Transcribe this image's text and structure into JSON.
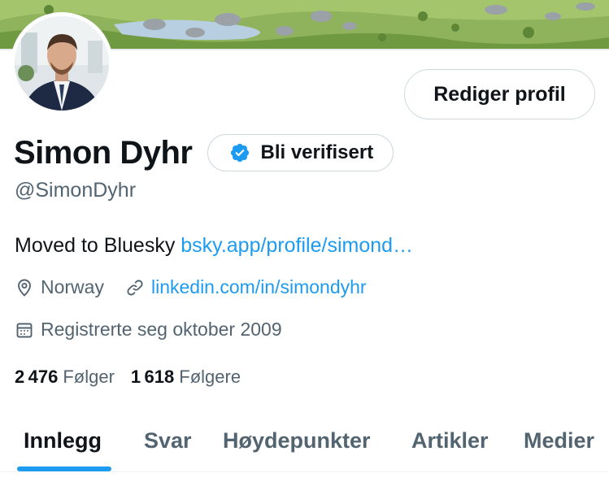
{
  "profile": {
    "name": "Simon Dyhr",
    "handle": "@SimonDyhr",
    "edit_label": "Rediger profil",
    "verify_label": "Bli verifisert",
    "bio_text": "Moved to Bluesky ",
    "bio_link": "bsky.app/profile/simond…",
    "location": "Norway",
    "website": "linkedin.com/in/simondyhr",
    "joined": "Registrerte seg oktober 2009",
    "following_count": "2 476",
    "following_label": "Følger",
    "followers_count": "1 618",
    "followers_label": "Følgere"
  },
  "tabs": [
    {
      "label": "Innlegg",
      "active": true
    },
    {
      "label": "Svar",
      "active": false
    },
    {
      "label": "Høydepunkter",
      "active": false
    },
    {
      "label": "Artikler",
      "active": false
    },
    {
      "label": "Medier",
      "active": false
    }
  ],
  "icons": {
    "verified": "verified-badge-icon",
    "location": "location-pin-icon",
    "website": "link-icon",
    "joined": "calendar-icon"
  },
  "colors": {
    "accent": "#1d9bf0",
    "text": "#0f1419",
    "secondary_text": "#536471",
    "border": "#cfd9de"
  }
}
